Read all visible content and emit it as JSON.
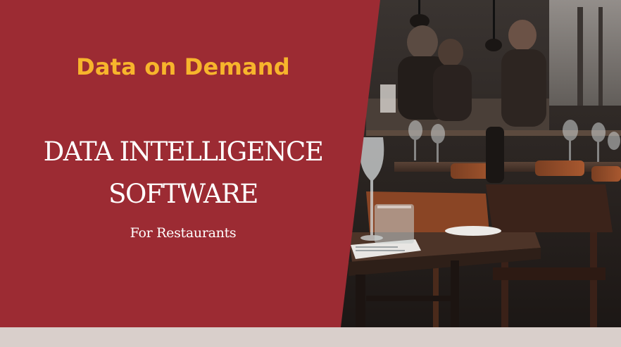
{
  "banner": {
    "tagline": "Data on Demand",
    "headline_line1": "DATA INTELLIGENCE",
    "headline_line2": "SOFTWARE",
    "subline": "For Restaurants"
  },
  "colors": {
    "panel_red": "#9c2b33",
    "tagline_gold": "#f7b52c",
    "text_white": "#ffffff",
    "bottom_strip": "#d9cfcb"
  },
  "icons": [
    "restaurant-photo"
  ]
}
